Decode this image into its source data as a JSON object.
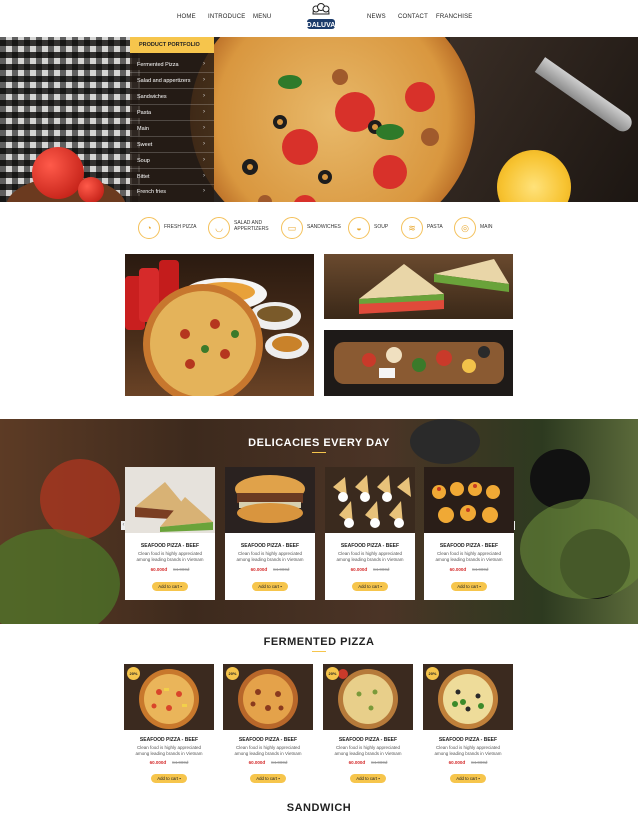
{
  "nav": {
    "items": [
      "HOME",
      "INTRODUCE",
      "MENU",
      "NEWS",
      "CONTACT",
      "FRANCHISE"
    ],
    "logo_text": "DALUVA"
  },
  "menu": {
    "header": "PRODUCT PORTFOLIO",
    "items": [
      "Fermented Pizza",
      "Salad and appertizers",
      "Sandwiches",
      "Pasta",
      "Main",
      "Sweet",
      "Soup",
      "Bittet",
      "French fries"
    ]
  },
  "categories": [
    "FRESH PIZZA",
    "SALAD AND APPERTIZERS",
    "SANDWICHES",
    "SOUP",
    "PASTA",
    "MAIN"
  ],
  "delicacies": {
    "title": "DELICACIES EVERY DAY",
    "cards": [
      {
        "name": "SEAFOOD PIZZA - BEEF",
        "desc": "Clean food is highly appreciated among leading brands in Vietnam",
        "price": "60.000đ",
        "old": "84.000đ",
        "btn": "Add to cart"
      },
      {
        "name": "SEAFOOD PIZZA - BEEF",
        "desc": "Clean food is highly appreciated among leading brands in Vietnam",
        "price": "60.000đ",
        "old": "84.000đ",
        "btn": "Add to cart"
      },
      {
        "name": "SEAFOOD PIZZA - BEEF",
        "desc": "Clean food is highly appreciated among leading brands in Vietnam",
        "price": "60.000đ",
        "old": "84.000đ",
        "btn": "Add to cart"
      },
      {
        "name": "SEAFOOD PIZZA - BEEF",
        "desc": "Clean food is highly appreciated among leading brands in Vietnam",
        "price": "60.000đ",
        "old": "84.000đ",
        "btn": "Add to cart"
      }
    ]
  },
  "fermented": {
    "title": "FERMENTED PIZZA",
    "cards": [
      {
        "badge": "20%",
        "name": "SEAFOOD PIZZA - BEEF",
        "desc": "Clean food is highly appreciated among leading brands in Vietnam",
        "price": "60.000đ",
        "old": "84.000đ",
        "btn": "Add to cart"
      },
      {
        "badge": "20%",
        "name": "SEAFOOD PIZZA - BEEF",
        "desc": "Clean food is highly appreciated among leading brands in Vietnam",
        "price": "60.000đ",
        "old": "84.000đ",
        "btn": "Add to cart"
      },
      {
        "badge": "20%",
        "name": "SEAFOOD PIZZA - BEEF",
        "desc": "Clean food is highly appreciated among leading brands in Vietnam",
        "price": "60.000đ",
        "old": "84.000đ",
        "btn": "Add to cart"
      },
      {
        "badge": "20%",
        "name": "SEAFOOD PIZZA - BEEF",
        "desc": "Clean food is highly appreciated among leading brands in Vietnam",
        "price": "60.000đ",
        "old": "84.000đ",
        "btn": "Add to cart"
      }
    ]
  },
  "sandwich": {
    "title": "SANDWICH"
  },
  "icons": {
    "chevron": "›",
    "cart": "cart-icon"
  }
}
